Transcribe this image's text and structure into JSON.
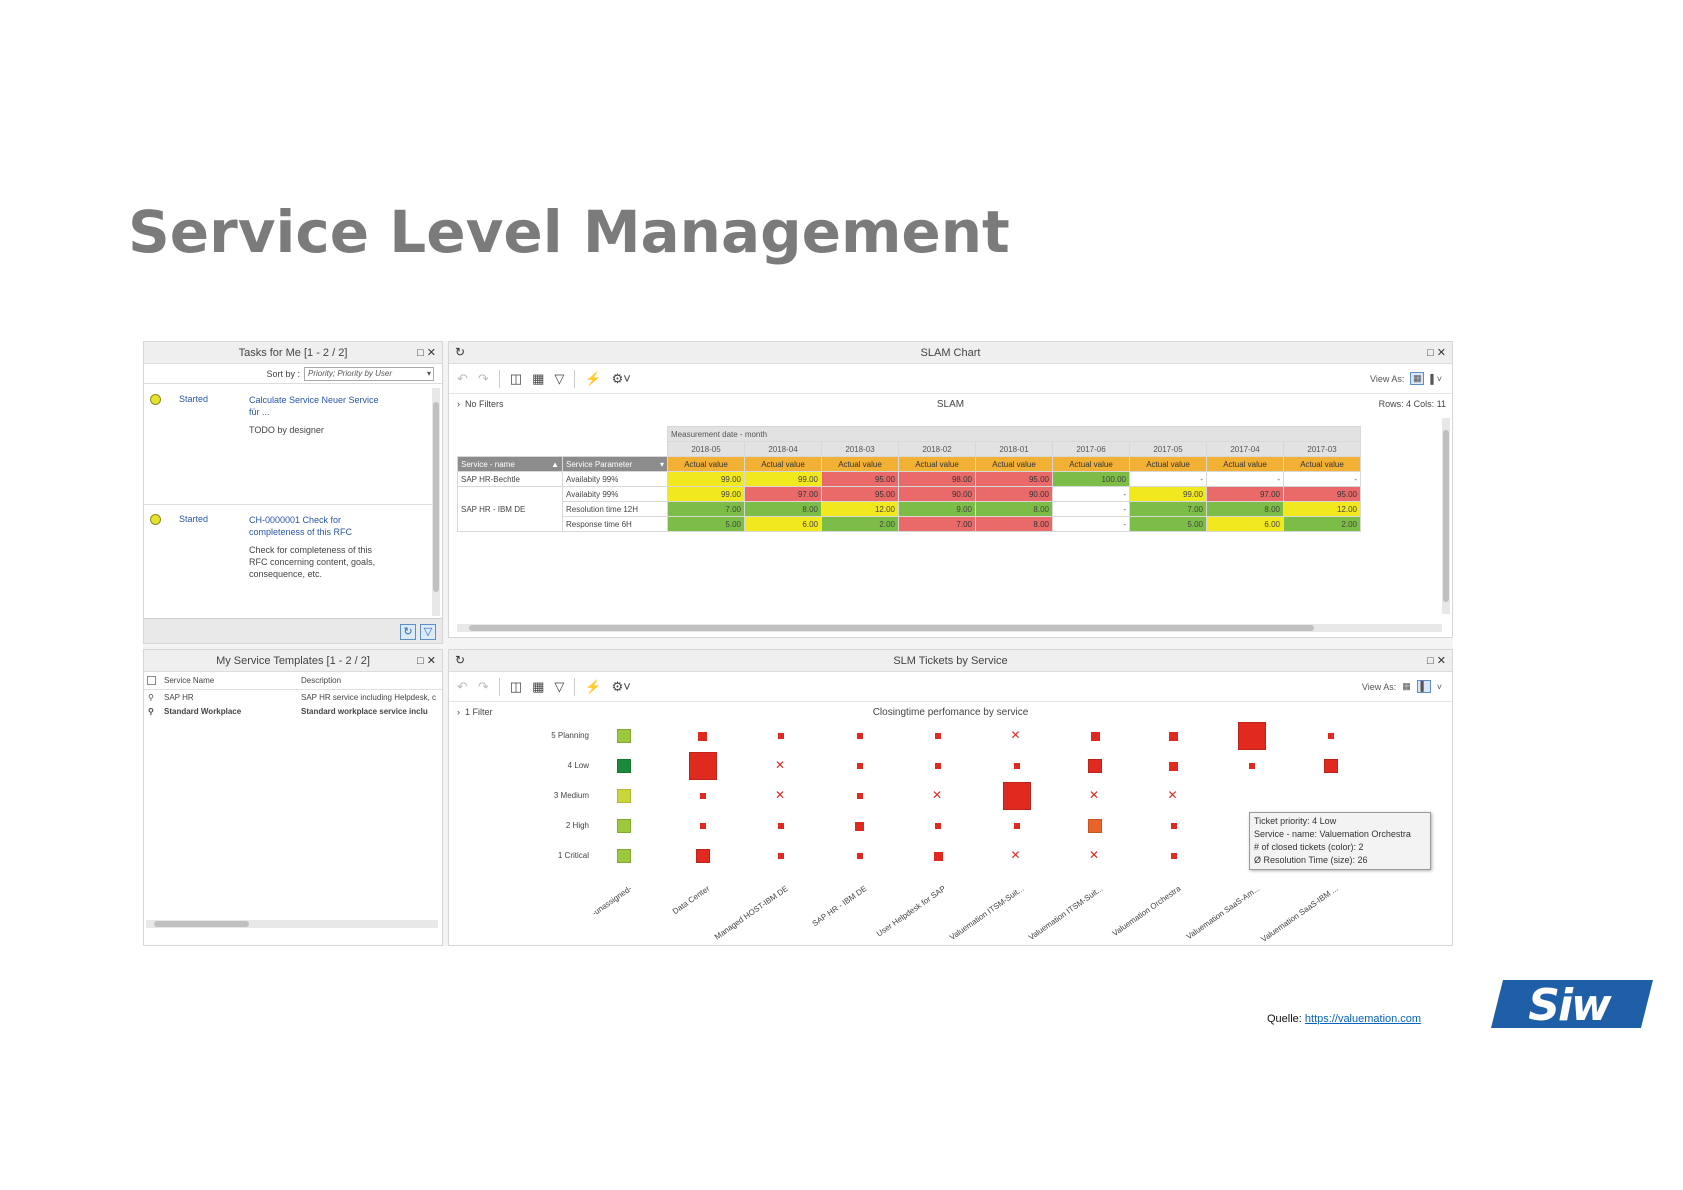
{
  "slide": {
    "title": "Service Level Management",
    "source_label": "Quelle:",
    "source_link": "https://valuemation.com",
    "logo_text": "SIW"
  },
  "tasks": {
    "title": "Tasks for Me [1 - 2 / 2]",
    "sort_label": "Sort by :",
    "sort_value": "Priority; Priority by User",
    "items": [
      {
        "status": "Started",
        "link": "Calculate Service Neuer Service für ...",
        "desc": "TODO by designer"
      },
      {
        "status": "Started",
        "link": "CH-0000001 Check for completeness of this RFC",
        "desc": "Check for completeness of this RFC concerning content, goals, consequence, etc."
      }
    ]
  },
  "templates": {
    "title": "My Service Templates [1 - 2 / 2]",
    "col_name": "Service Name",
    "col_desc": "Description",
    "rows": [
      {
        "name": "SAP HR",
        "desc": "SAP HR service including Helpdesk, c",
        "bold": false
      },
      {
        "name": "Standard Workplace",
        "desc": "Standard workplace service inclu",
        "bold": true
      }
    ]
  },
  "slam": {
    "title": "SLAM Chart",
    "view_as": "View As:",
    "filter": "No Filters",
    "center_title": "SLAM",
    "rows_cols": "Rows: 4  Cols: 11",
    "measure_header": "Measurement date - month",
    "months": [
      "2018-05",
      "2018-04",
      "2018-03",
      "2018-02",
      "2018-01",
      "2017-06",
      "2017-05",
      "2017-04",
      "2017-03"
    ],
    "actual_label": "Actual value",
    "col_service": "Service - name",
    "col_param": "Service Parameter",
    "rows": [
      {
        "service": "SAP HR-Bechtle",
        "param": "Availabity 99%",
        "cells": [
          [
            "99.00",
            "y"
          ],
          [
            "99.00",
            "y"
          ],
          [
            "95.00",
            "r"
          ],
          [
            "98.00",
            "r"
          ],
          [
            "95.00",
            "r"
          ],
          [
            "100.00",
            "g"
          ],
          [
            "-",
            "w"
          ],
          [
            "-",
            "w"
          ],
          [
            "-",
            "w"
          ]
        ]
      },
      {
        "service": "SAP HR - IBM DE",
        "param": "Availabity 99%",
        "cells": [
          [
            "99.00",
            "y"
          ],
          [
            "97.00",
            "r"
          ],
          [
            "95.00",
            "r"
          ],
          [
            "90.00",
            "r"
          ],
          [
            "90.00",
            "r"
          ],
          [
            "-",
            "w"
          ],
          [
            "99.00",
            "y"
          ],
          [
            "97.00",
            "r"
          ],
          [
            "95.00",
            "r"
          ]
        ]
      },
      {
        "service": "",
        "param": "Resolution time 12H",
        "cells": [
          [
            "7.00",
            "g"
          ],
          [
            "8.00",
            "g"
          ],
          [
            "12.00",
            "y"
          ],
          [
            "9.00",
            "g"
          ],
          [
            "8.00",
            "g"
          ],
          [
            "-",
            "w"
          ],
          [
            "7.00",
            "g"
          ],
          [
            "8.00",
            "g"
          ],
          [
            "12.00",
            "y"
          ]
        ]
      },
      {
        "service": "",
        "param": "Response time 6H",
        "cells": [
          [
            "5.00",
            "g"
          ],
          [
            "6.00",
            "y"
          ],
          [
            "2.00",
            "g"
          ],
          [
            "7.00",
            "r"
          ],
          [
            "8.00",
            "r"
          ],
          [
            "-",
            "w"
          ],
          [
            "5.00",
            "g"
          ],
          [
            "6.00",
            "y"
          ],
          [
            "2.00",
            "g"
          ]
        ]
      }
    ]
  },
  "tickets": {
    "title": "SLM Tickets by Service",
    "view_as": "View As:",
    "filter": "1 Filter",
    "center_title": "Closingtime perfomance by service",
    "priorities": [
      "5 Planning",
      "4 Low",
      "3 Medium",
      "2 High",
      "1 Critical"
    ],
    "services": [
      "-unassigned-",
      "Data Center",
      "Managed HOST-IBM DE",
      "SAP HR - IBM DE",
      "User Helpdesk for SAP",
      "Valuemation ITSM-Suit...",
      "Valuemation ITSM-Suit...",
      "Valuemation Orchestra",
      "Valuemation SaaS-Am...",
      "Valuemation SaaS-IBM ..."
    ],
    "tooltip": [
      "Ticket priority: 4 Low",
      "Service - name: Valuemation Orchestra",
      "# of closed tickets (color): 2",
      "Ø Resolution Time (size): 26"
    ]
  },
  "chart_data": {
    "type": "scatter",
    "title": "Closingtime perfomance by service",
    "x_categories": [
      "-unassigned-",
      "Data Center",
      "Managed HOST-IBM DE",
      "SAP HR - IBM DE",
      "User Helpdesk for SAP",
      "Valuemation ITSM-Suit...",
      "Valuemation ITSM-Suit...",
      "Valuemation Orchestra",
      "Valuemation SaaS-Am...",
      "Valuemation SaaS-IBM ..."
    ],
    "y_categories": [
      "1 Critical",
      "2 High",
      "3 Medium",
      "4 Low",
      "5 Planning"
    ],
    "encoding": {
      "color": "# of closed tickets",
      "size": "Ø Resolution Time"
    },
    "marker_colors": {
      "light-green": "#9bc83c",
      "yellow-green": "#c8d83a",
      "dark-green": "#1a8a3a",
      "red": "#e02a1f",
      "orange": "#e8642a"
    },
    "points": [
      {
        "x": "-unassigned-",
        "y": "5 Planning",
        "marker": "square",
        "color": "light-green",
        "size": "medium"
      },
      {
        "x": "-unassigned-",
        "y": "4 Low",
        "marker": "square",
        "color": "dark-green",
        "size": "medium"
      },
      {
        "x": "-unassigned-",
        "y": "3 Medium",
        "marker": "square",
        "color": "yellow-green",
        "size": "medium"
      },
      {
        "x": "-unassigned-",
        "y": "2 High",
        "marker": "square",
        "color": "light-green",
        "size": "medium"
      },
      {
        "x": "-unassigned-",
        "y": "1 Critical",
        "marker": "square",
        "color": "light-green",
        "size": "medium"
      },
      {
        "x": "Data Center",
        "y": "5 Planning",
        "marker": "square",
        "color": "red",
        "size": "small"
      },
      {
        "x": "Data Center",
        "y": "4 Low",
        "marker": "square",
        "color": "red",
        "size": "large"
      },
      {
        "x": "Data Center",
        "y": "3 Medium",
        "marker": "square",
        "color": "red",
        "size": "tiny"
      },
      {
        "x": "Data Center",
        "y": "2 High",
        "marker": "square",
        "color": "red",
        "size": "tiny"
      },
      {
        "x": "Data Center",
        "y": "1 Critical",
        "marker": "square",
        "color": "red",
        "size": "medium"
      },
      {
        "x": "Managed HOST-IBM DE",
        "y": "5 Planning",
        "marker": "square",
        "color": "red",
        "size": "tiny"
      },
      {
        "x": "Managed HOST-IBM DE",
        "y": "4 Low",
        "marker": "x",
        "color": "red",
        "size": "small"
      },
      {
        "x": "Managed HOST-IBM DE",
        "y": "3 Medium",
        "marker": "x",
        "color": "red",
        "size": "small"
      },
      {
        "x": "Managed HOST-IBM DE",
        "y": "2 High",
        "marker": "square",
        "color": "red",
        "size": "tiny"
      },
      {
        "x": "Managed HOST-IBM DE",
        "y": "1 Critical",
        "marker": "square",
        "color": "red",
        "size": "tiny"
      },
      {
        "x": "SAP HR - IBM DE",
        "y": "5 Planning",
        "marker": "square",
        "color": "red",
        "size": "tiny"
      },
      {
        "x": "SAP HR - IBM DE",
        "y": "4 Low",
        "marker": "square",
        "color": "red",
        "size": "tiny"
      },
      {
        "x": "SAP HR - IBM DE",
        "y": "3 Medium",
        "marker": "square",
        "color": "red",
        "size": "tiny"
      },
      {
        "x": "SAP HR - IBM DE",
        "y": "2 High",
        "marker": "square",
        "color": "red",
        "size": "small"
      },
      {
        "x": "SAP HR - IBM DE",
        "y": "1 Critical",
        "marker": "square",
        "color": "red",
        "size": "tiny"
      },
      {
        "x": "User Helpdesk for SAP",
        "y": "5 Planning",
        "marker": "square",
        "color": "red",
        "size": "tiny"
      },
      {
        "x": "User Helpdesk for SAP",
        "y": "4 Low",
        "marker": "square",
        "color": "red",
        "size": "tiny"
      },
      {
        "x": "User Helpdesk for SAP",
        "y": "3 Medium",
        "marker": "x",
        "color": "red",
        "size": "small"
      },
      {
        "x": "User Helpdesk for SAP",
        "y": "2 High",
        "marker": "square",
        "color": "red",
        "size": "tiny"
      },
      {
        "x": "User Helpdesk for SAP",
        "y": "1 Critical",
        "marker": "square",
        "color": "red",
        "size": "small"
      },
      {
        "x": "Valuemation ITSM-Suit... (1)",
        "y": "5 Planning",
        "marker": "x",
        "color": "red",
        "size": "small"
      },
      {
        "x": "Valuemation ITSM-Suit... (1)",
        "y": "4 Low",
        "marker": "square",
        "color": "red",
        "size": "tiny"
      },
      {
        "x": "Valuemation ITSM-Suit... (1)",
        "y": "3 Medium",
        "marker": "square",
        "color": "red",
        "size": "large"
      },
      {
        "x": "Valuemation ITSM-Suit... (1)",
        "y": "2 High",
        "marker": "square",
        "color": "red",
        "size": "tiny"
      },
      {
        "x": "Valuemation ITSM-Suit... (1)",
        "y": "1 Critical",
        "marker": "x",
        "color": "red",
        "size": "small"
      },
      {
        "x": "Valuemation ITSM-Suit... (2)",
        "y": "5 Planning",
        "marker": "square",
        "color": "red",
        "size": "small"
      },
      {
        "x": "Valuemation ITSM-Suit... (2)",
        "y": "4 Low",
        "marker": "square",
        "color": "red",
        "size": "medium"
      },
      {
        "x": "Valuemation ITSM-Suit... (2)",
        "y": "3 Medium",
        "marker": "x",
        "color": "red",
        "size": "small"
      },
      {
        "x": "Valuemation ITSM-Suit... (2)",
        "y": "2 High",
        "marker": "square",
        "color": "orange",
        "size": "medium"
      },
      {
        "x": "Valuemation ITSM-Suit... (2)",
        "y": "1 Critical",
        "marker": "x",
        "color": "red",
        "size": "small"
      },
      {
        "x": "Valuemation Orchestra",
        "y": "5 Planning",
        "marker": "square",
        "color": "red",
        "size": "small"
      },
      {
        "x": "Valuemation Orchestra",
        "y": "4 Low",
        "marker": "square",
        "color": "red",
        "size": "small"
      },
      {
        "x": "Valuemation Orchestra",
        "y": "3 Medium",
        "marker": "x",
        "color": "red",
        "size": "small"
      },
      {
        "x": "Valuemation Orchestra",
        "y": "2 High",
        "marker": "square",
        "color": "red",
        "size": "tiny"
      },
      {
        "x": "Valuemation Orchestra",
        "y": "1 Critical",
        "marker": "square",
        "color": "red",
        "size": "tiny"
      },
      {
        "x": "Valuemation SaaS-Am...",
        "y": "5 Planning",
        "marker": "square",
        "color": "red",
        "size": "large"
      },
      {
        "x": "Valuemation SaaS-Am...",
        "y": "4 Low",
        "marker": "square",
        "color": "red",
        "size": "tiny"
      },
      {
        "x": "Valuemation SaaS-Am...",
        "y": "1 Critical",
        "marker": "square",
        "color": "red",
        "size": "tiny"
      },
      {
        "x": "Valuemation SaaS-IBM ...",
        "y": "5 Planning",
        "marker": "square",
        "color": "red",
        "size": "tiny"
      },
      {
        "x": "Valuemation SaaS-IBM ...",
        "y": "4 Low",
        "marker": "square",
        "color": "red",
        "size": "medium"
      },
      {
        "x": "Valuemation SaaS-IBM ...",
        "y": "1 Critical",
        "marker": "x",
        "color": "red",
        "size": "small"
      }
    ]
  },
  "icons": {
    "refresh": "refresh-icon",
    "undo": "undo-icon",
    "redo": "redo-icon",
    "filter": "filter-icon",
    "gear": "gear-icon",
    "maximize": "maximize-icon",
    "close": "close-icon"
  },
  "colors": {
    "title_gray": "#7b7b7b",
    "orange_header": "#f2b134",
    "red": "#ea6a6a",
    "yellow": "#f1e81e",
    "green": "#7bbd46",
    "logo_blue": "#1f5fa8"
  }
}
